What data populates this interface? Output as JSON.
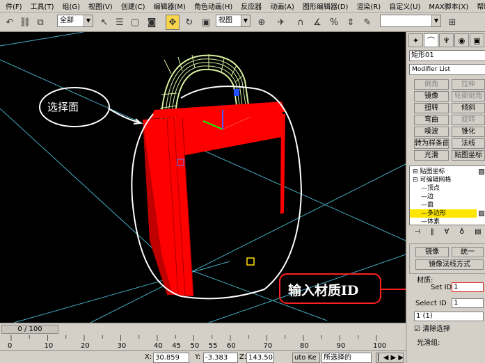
{
  "menu": [
    "件(F)",
    "工具(T)",
    "组(G)",
    "视图(V)",
    "创建(C)",
    "编辑器(M)",
    "角色动画(H)",
    "反应器",
    "动画(A)",
    "图形编辑器(D)",
    "渲染(R)",
    "自定义(U)",
    "MAX脚本(X)",
    "帮助(H)"
  ],
  "toolbar": {
    "selection_filter": "全部",
    "reference_coord": "视图"
  },
  "viewport": {
    "annotation_select_face": "选择面",
    "annotation_input_matid": "输入材质ID"
  },
  "panel": {
    "object_name": "矩形01",
    "modifier_list": "Modifier List",
    "modifier_buttons": [
      {
        "label": "倒角",
        "enabled": false
      },
      {
        "label": "拉伸",
        "enabled": false
      },
      {
        "label": "镜像",
        "enabled": true
      },
      {
        "label": "轮廓倒角",
        "enabled": false
      },
      {
        "label": "扭转",
        "enabled": true
      },
      {
        "label": "倾斜",
        "enabled": true
      },
      {
        "label": "弯曲",
        "enabled": true
      },
      {
        "label": "旋转",
        "enabled": false
      },
      {
        "label": "噪波",
        "enabled": true
      },
      {
        "label": "锥化",
        "enabled": true
      },
      {
        "label": "转为样条曲线",
        "enabled": true
      },
      {
        "label": "法线",
        "enabled": true
      },
      {
        "label": "光滑",
        "enabled": true
      },
      {
        "label": "贴图坐标",
        "enabled": true
      }
    ],
    "stack": [
      {
        "label": "贴图坐标",
        "indent": 0,
        "selected": false
      },
      {
        "label": "可编辑网格",
        "indent": 0,
        "selected": false
      },
      {
        "label": "顶点",
        "indent": 1,
        "selected": false
      },
      {
        "label": "边",
        "indent": 1,
        "selected": false
      },
      {
        "label": "面",
        "indent": 1,
        "selected": false
      },
      {
        "label": "多边形",
        "indent": 1,
        "selected": true
      },
      {
        "label": "体素",
        "indent": 1,
        "selected": false
      }
    ],
    "mirror_label": "镜像",
    "unify_label": "统一",
    "mirror_normal_label": "镜像法线方式",
    "material_group": "材质:",
    "set_id_label": "Set ID",
    "set_id_value": "1",
    "select_id_label": "Select ID",
    "select_id_value": "1",
    "id_dropdown": "1 (1)",
    "clear_selection_label": "清除选择",
    "smoothing_group": "光滑组:"
  },
  "timeline": {
    "frame": "0 / 100",
    "ticks": [
      "0",
      "10",
      "20",
      "30",
      "40",
      "45",
      "50",
      "55",
      "60",
      "70",
      "80",
      "90",
      "100"
    ]
  },
  "status": {
    "x_label": "X:",
    "x_value": "30.859",
    "y_label": "Y:",
    "y_value": "-3.383",
    "z_label": "Z:",
    "z_value": "143.506",
    "auto_key": "uto Ke",
    "set_key_dropdown": "所选择的"
  },
  "colors": {
    "bag_red": "#ff0000",
    "handle_wire": "#d8f0a0",
    "grid_line": "#4ec0d8",
    "annotation": "#ffffff",
    "stack_highlight": "#ffe600",
    "callout_red": "#ff2020"
  }
}
